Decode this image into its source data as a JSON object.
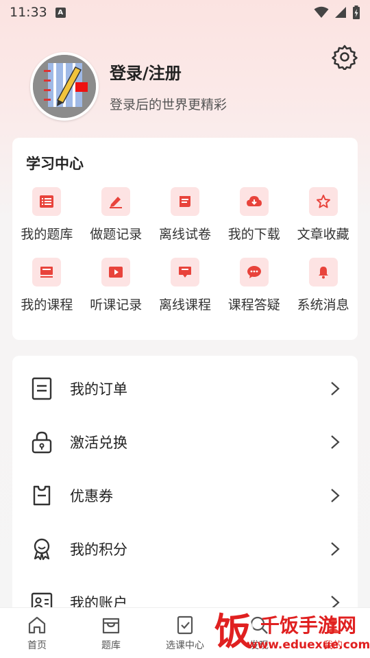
{
  "status_bar": {
    "time": "11:33",
    "notification_badge": "A"
  },
  "profile": {
    "title": "登录/注册",
    "subtitle": "登录后的世界更精彩"
  },
  "learning_center": {
    "title": "学习中心",
    "items": [
      {
        "label": "我的题库",
        "icon": "question-bank-icon"
      },
      {
        "label": "做题记录",
        "icon": "edit-record-icon"
      },
      {
        "label": "离线试卷",
        "icon": "offline-paper-icon"
      },
      {
        "label": "我的下载",
        "icon": "download-icon"
      },
      {
        "label": "文章收藏",
        "icon": "star-icon"
      },
      {
        "label": "我的课程",
        "icon": "course-icon"
      },
      {
        "label": "听课记录",
        "icon": "play-record-icon"
      },
      {
        "label": "离线课程",
        "icon": "offline-course-icon"
      },
      {
        "label": "课程答疑",
        "icon": "chat-icon"
      },
      {
        "label": "系统消息",
        "icon": "bell-icon"
      }
    ]
  },
  "menu": {
    "items": [
      {
        "label": "我的订单",
        "icon": "order-icon"
      },
      {
        "label": "激活兑换",
        "icon": "lock-icon"
      },
      {
        "label": "优惠券",
        "icon": "coupon-icon"
      },
      {
        "label": "我的积分",
        "icon": "medal-icon"
      },
      {
        "label": "我的账户",
        "icon": "account-icon"
      }
    ]
  },
  "bottom_nav": {
    "items": [
      {
        "label": "首页",
        "icon": "home-icon"
      },
      {
        "label": "题库",
        "icon": "question-bank-icon"
      },
      {
        "label": "选课中心",
        "icon": "course-select-icon"
      },
      {
        "label": "发现",
        "icon": "discover-icon"
      },
      {
        "label": "我的",
        "icon": "profile-icon"
      }
    ],
    "active": "我的"
  },
  "watermark": {
    "brand": "千饭手游网",
    "url": "www.eduexue.com",
    "logo_char": "饭"
  },
  "colors": {
    "accent": "#e8433b",
    "icon_bg": "#fde3e3"
  }
}
